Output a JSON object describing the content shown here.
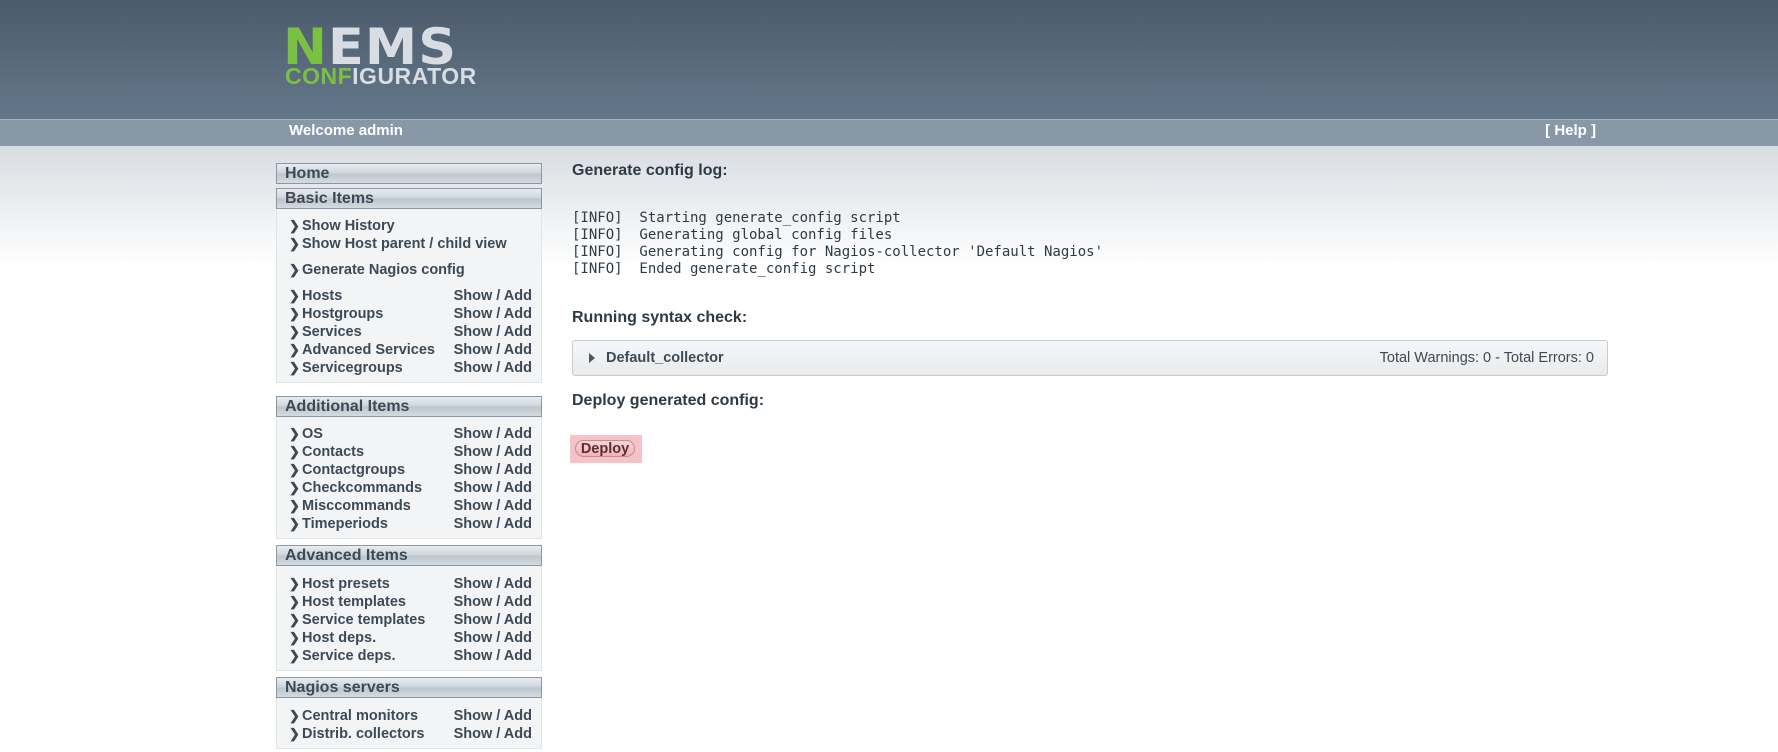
{
  "header": {
    "logo": {
      "line1_green": "N",
      "line1_rest": "EMS",
      "line2_green": "CONF",
      "line2_rest": "IGURATOR"
    },
    "welcome": "Welcome admin",
    "help": "[ Help ]"
  },
  "sidebar": {
    "home": "Home",
    "basic": {
      "title": "Basic Items",
      "links": [
        "Show History",
        "Show Host parent / child view",
        "Generate Nagios config"
      ],
      "items": [
        {
          "label": "Hosts",
          "action": "Show / Add"
        },
        {
          "label": "Hostgroups",
          "action": "Show / Add"
        },
        {
          "label": "Services",
          "action": "Show / Add"
        },
        {
          "label": "Advanced Services",
          "action": "Show / Add"
        },
        {
          "label": "Servicegroups",
          "action": "Show / Add"
        }
      ]
    },
    "additional": {
      "title": "Additional Items",
      "items": [
        {
          "label": "OS",
          "action": "Show / Add"
        },
        {
          "label": "Contacts",
          "action": "Show / Add"
        },
        {
          "label": "Contactgroups",
          "action": "Show / Add"
        },
        {
          "label": "Checkcommands",
          "action": "Show / Add"
        },
        {
          "label": "Misccommands",
          "action": "Show / Add"
        },
        {
          "label": "Timeperiods",
          "action": "Show / Add"
        }
      ]
    },
    "advanced": {
      "title": "Advanced Items",
      "items": [
        {
          "label": "Host presets",
          "action": "Show / Add"
        },
        {
          "label": "Host templates",
          "action": "Show / Add"
        },
        {
          "label": "Service templates",
          "action": "Show / Add"
        },
        {
          "label": "Host deps.",
          "action": "Show / Add"
        },
        {
          "label": "Service deps.",
          "action": "Show / Add"
        }
      ]
    },
    "servers": {
      "title": "Nagios servers",
      "items": [
        {
          "label": "Central monitors",
          "action": "Show / Add"
        },
        {
          "label": "Distrib. collectors",
          "action": "Show / Add"
        }
      ]
    }
  },
  "main": {
    "log_title": "Generate config log:",
    "log_lines": [
      "[INFO]  Starting generate_config script",
      "[INFO]  Generating global config files",
      "[INFO]  Generating config for Nagios-collector 'Default Nagios'",
      "[INFO]  Ended generate_config script"
    ],
    "syntax_title": "Running syntax check:",
    "collector": {
      "name": "Default_collector",
      "stats": "Total Warnings: 0  -  Total Errors: 0"
    },
    "deploy_title": "Deploy generated config:",
    "deploy_button": "Deploy"
  },
  "colors": {
    "accent_green": "#7ac143",
    "header": "#56677a",
    "deploy_bg": "#f5c3c7"
  },
  "icons": {
    "chevron": "chevron-right-icon",
    "expand": "expand-triangle-icon"
  }
}
